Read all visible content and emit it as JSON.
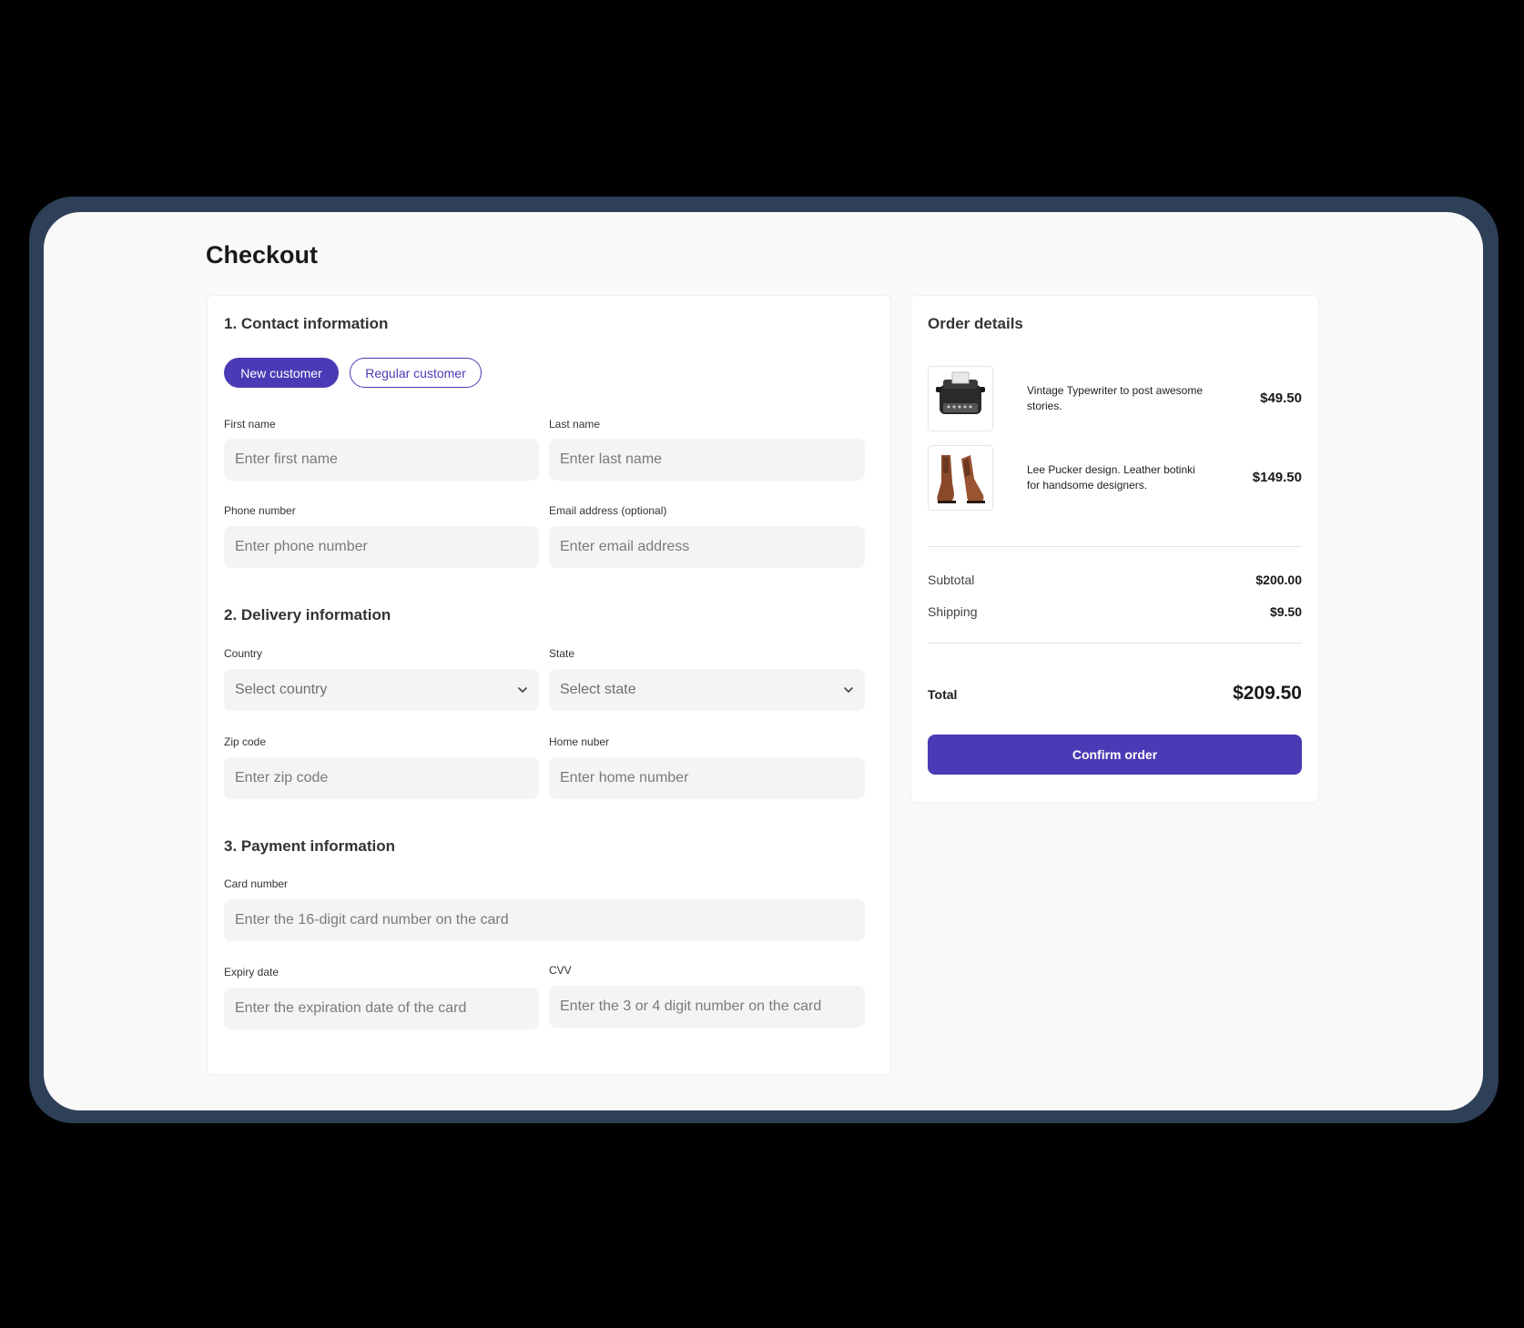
{
  "page": {
    "title": "Checkout"
  },
  "contact": {
    "title": "1. Contact information",
    "tabs": {
      "new_customer": "New customer",
      "regular_customer": "Regular customer"
    },
    "first_name": {
      "label": "First name",
      "placeholder": "Enter first name"
    },
    "last_name": {
      "label": "Last name",
      "placeholder": "Enter last name"
    },
    "phone": {
      "label": "Phone number",
      "placeholder": "Enter phone number"
    },
    "email": {
      "label": "Email address (optional)",
      "placeholder": "Enter email address"
    }
  },
  "delivery": {
    "title": "2. Delivery information",
    "country": {
      "label": "Country",
      "value": "Select country"
    },
    "state": {
      "label": "State",
      "value": "Select state"
    },
    "zip": {
      "label": "Zip code",
      "placeholder": "Enter zip code"
    },
    "home": {
      "label": "Home nuber",
      "placeholder": "Enter home number"
    }
  },
  "payment": {
    "title": "3. Payment information",
    "card_number": {
      "label": "Card number",
      "placeholder": "Enter the 16-digit card number on the card"
    },
    "expiry": {
      "label": "Expiry date",
      "placeholder": "Enter the expiration date of the card"
    },
    "cvv": {
      "label": "CVV",
      "placeholder": "Enter the 3 or 4 digit number on the card"
    }
  },
  "order": {
    "title": "Order details",
    "items": [
      {
        "name": "Vintage Typewriter to post awesome stories.",
        "price": "$49.50",
        "icon": "typewriter-image"
      },
      {
        "name": "Lee Pucker design. Leather botinki for handsome designers.",
        "price": "$149.50",
        "icon": "boots-image"
      }
    ],
    "subtotal_label": "Subtotal",
    "subtotal_value": "$200.00",
    "shipping_label": "Shipping",
    "shipping_value": "$9.50",
    "total_label": "Total",
    "total_value": "$209.50",
    "confirm_label": "Confirm order"
  },
  "colors": {
    "accent": "#4a3ab5",
    "frame": "#2e4057",
    "input_bg": "#f3f4f3"
  }
}
